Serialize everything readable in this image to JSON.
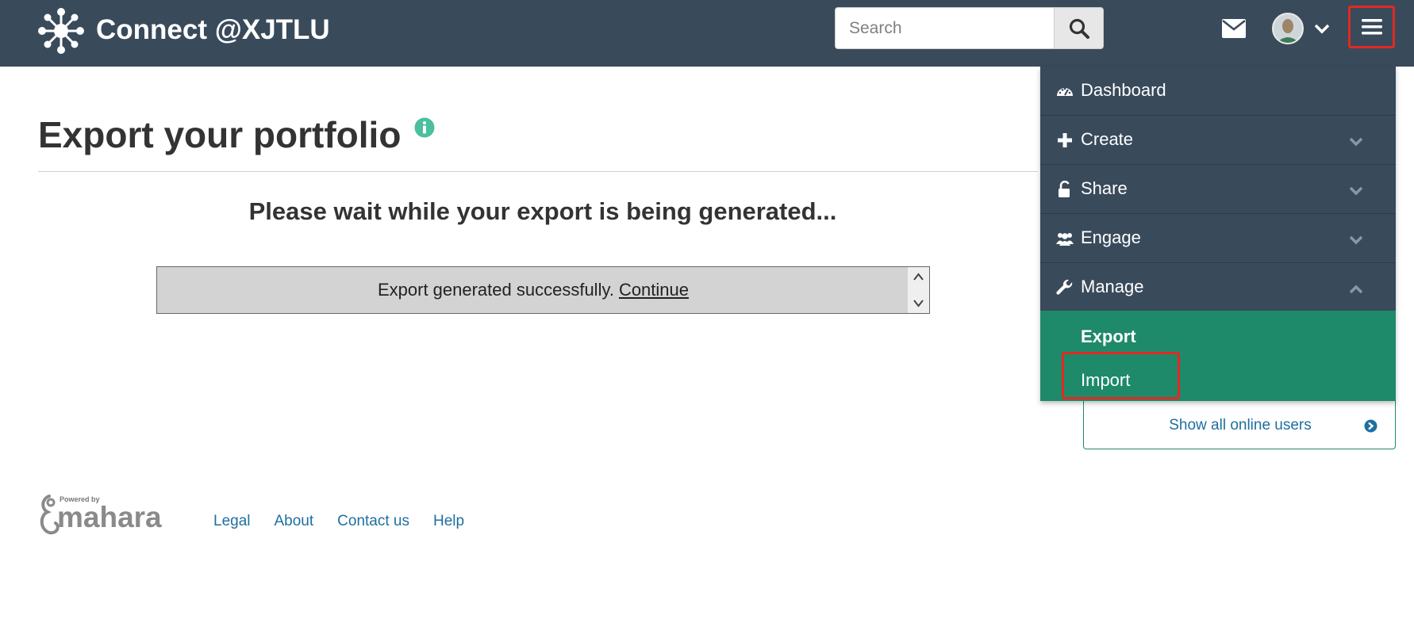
{
  "header": {
    "site_title": "Connect @XJTLU",
    "search_placeholder": "Search",
    "search_value": ""
  },
  "main": {
    "page_title": "Export your portfolio",
    "wait_message": "Please wait while your export is being generated...",
    "progress_message": "Export generated successfully.",
    "continue_link": "Continue"
  },
  "nav": {
    "items": [
      {
        "label": "Dashboard",
        "icon": "dashboard-icon"
      },
      {
        "label": "Create",
        "icon": "plus-icon",
        "chevron": "chevron-down"
      },
      {
        "label": "Share",
        "icon": "unlock-icon",
        "chevron": "chevron-down"
      },
      {
        "label": "Engage",
        "icon": "users-icon",
        "chevron": "chevron-down"
      },
      {
        "label": "Manage",
        "icon": "wrench-icon",
        "chevron": "chevron-up"
      }
    ],
    "sub_items": [
      {
        "label": "Export",
        "active": true
      },
      {
        "label": "Import",
        "highlighted": true
      }
    ]
  },
  "sidebar": {
    "online_users_link": "Show all online users"
  },
  "footer": {
    "links": [
      "Legal",
      "About",
      "Contact us",
      "Help"
    ]
  },
  "colors": {
    "header_bg": "#394a5b",
    "accent_green": "#1e8a69",
    "link_blue": "#1e6f9f",
    "highlight_red": "#e02a24"
  }
}
